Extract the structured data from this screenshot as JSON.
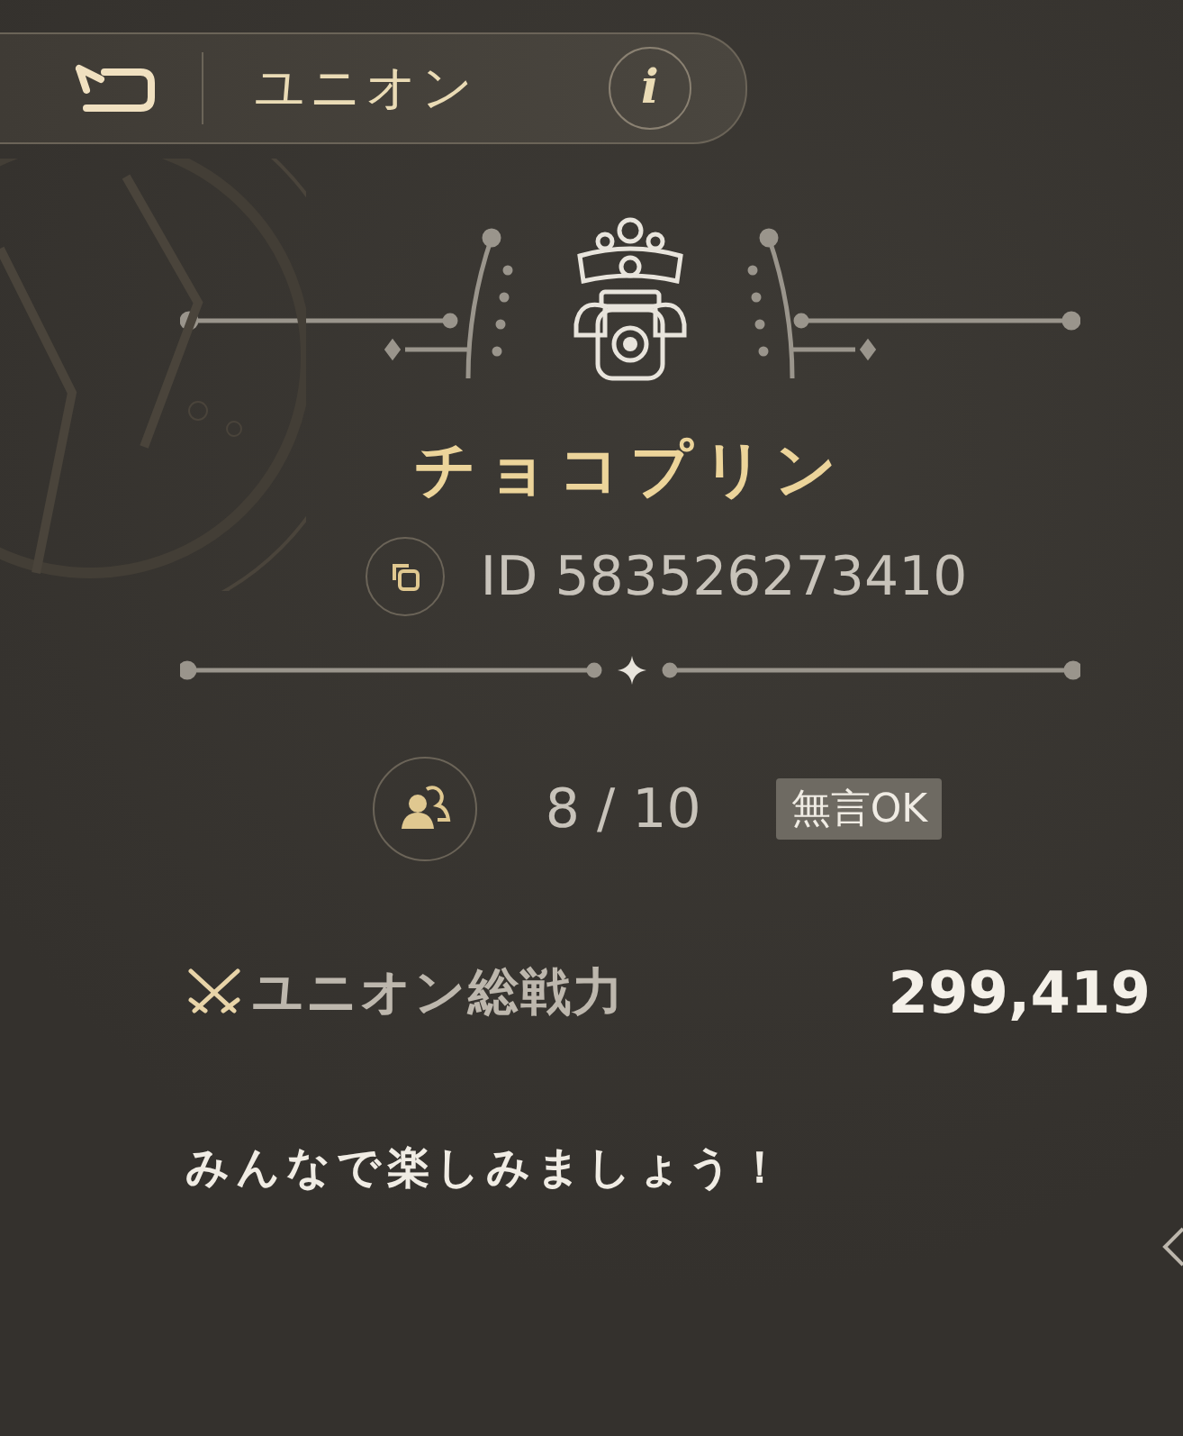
{
  "header": {
    "title": "ユニオン",
    "info_label": "i"
  },
  "union": {
    "name": "チョコプリン",
    "id": "ID 583526273410",
    "members": "8 / 10",
    "tag": "無言OK",
    "power_label": "ユニオン総戦力",
    "power_value": "299,419",
    "motto": "みんなで楽しみましょう！"
  }
}
